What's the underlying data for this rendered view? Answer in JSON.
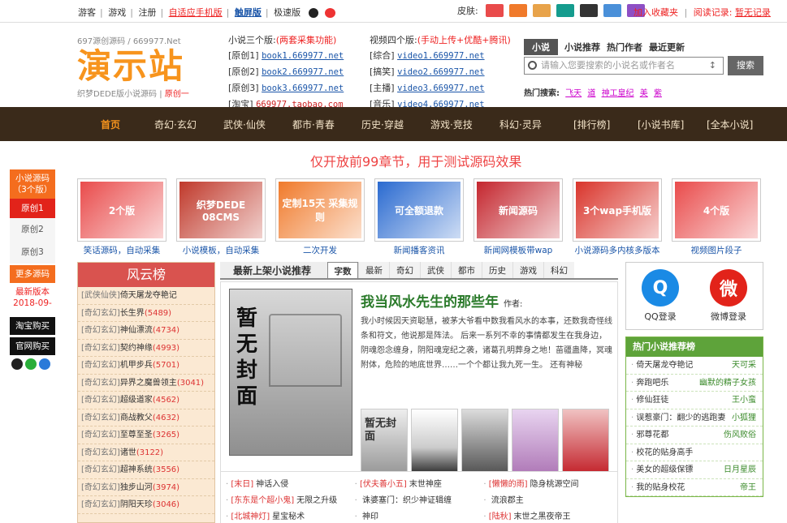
{
  "topbar": {
    "links": [
      "游客",
      "游戏",
      "注册",
      "自适应手机版",
      "触屏版",
      "极速版"
    ],
    "skin_label": "皮肤:",
    "skins": [
      "#e94b4b",
      "#f07a2b",
      "#e8a34a",
      "#159c8e",
      "#333333",
      "#4a90d9",
      "#8e4fc4"
    ],
    "bookmark": "加入收藏夹",
    "history": "阅读记录:",
    "history_link": "暂无记录"
  },
  "logo": {
    "sub1": "697源创源码 / 669977.Net",
    "big": "演示站",
    "sub2": "织梦DEDE版小说源码",
    "sub2_link": "原创一"
  },
  "novel_versions": {
    "title": "小说三个版:",
    "title_note": "(两套采集功能)",
    "rows": [
      {
        "label": "[原创1]",
        "link": "book1.669977.net"
      },
      {
        "label": "[原创2]",
        "link": "book2.669977.net"
      },
      {
        "label": "[原创3]",
        "link": "book3.669977.net"
      },
      {
        "label": "[淘宝]",
        "link": "669977.taobao.com"
      }
    ]
  },
  "video_versions": {
    "title": "视频四个版:",
    "title_note": "(手动上传+优酷+腾讯)",
    "rows": [
      {
        "label": "[综合]",
        "link": "video1.669977.net"
      },
      {
        "label": "[搞笑]",
        "link": "video2.669977.net"
      },
      {
        "label": "[主播]",
        "link": "video3.669977.net"
      },
      {
        "label": "[音乐]",
        "link": "video4.669977.net"
      }
    ]
  },
  "search": {
    "tabs": [
      "小说",
      "小说推荐",
      "热门作者",
      "最近更新"
    ],
    "placeholder": "请输入您要搜索的小说名或作者名",
    "button": "搜索",
    "hot_label": "热门搜索:",
    "hot": [
      "飞天",
      "道",
      "神工皇纪",
      "美",
      "紫"
    ]
  },
  "nav": [
    "首页",
    "奇幻·玄幻",
    "武侠·仙侠",
    "都市·青春",
    "历史·穿越",
    "游戏·竞技",
    "科幻·灵异",
    "[排行榜]",
    "[小说书库]",
    "[全本小说]"
  ],
  "notice": "仅开放前99章节，用于测试源码效果",
  "left_sidebar": {
    "title": "小说源码",
    "title_note": "（3个版）",
    "items": [
      "原创1",
      "原创2",
      "原创3"
    ],
    "more": "更多源码",
    "update": "最新版本2018-09-",
    "taobao": "淘宝购买",
    "official": "官网购买"
  },
  "banners": [
    {
      "caption": "笑话源码，自动采集",
      "text": "2个版",
      "color": "#e94b4b"
    },
    {
      "caption": "小说模板，自动采集",
      "text": "织梦DEDE 08CMS",
      "color": "#c0392b"
    },
    {
      "caption": "二次开发",
      "text": "定制15天 采集规则",
      "color": "#f07a2b"
    },
    {
      "caption": "新闻播客资讯",
      "text": "可全额退款",
      "color": "#2a6ad0"
    },
    {
      "caption": "新闻网模板带wap",
      "text": "新闻源码",
      "color": "#c4262e"
    },
    {
      "caption": "小说源码多内核多版本",
      "text": "3个wap手机版",
      "color": "#d9342b"
    },
    {
      "caption": "视频图片段子",
      "text": "4个版",
      "color": "#e94b4b"
    }
  ],
  "rank": {
    "title": "风云榜",
    "rows": [
      {
        "cat": "[武侠仙侠]",
        "name": "倚天屠龙夺艳记",
        "count": ""
      },
      {
        "cat": "[奇幻玄幻]",
        "name": "长生界",
        "count": "(5489)"
      },
      {
        "cat": "[奇幻玄幻]",
        "name": "神仙漂流",
        "count": "(4734)"
      },
      {
        "cat": "[奇幻玄幻]",
        "name": "契约神缘",
        "count": "(4993)"
      },
      {
        "cat": "[奇幻玄幻]",
        "name": "机甲步兵",
        "count": "(5701)"
      },
      {
        "cat": "[奇幻玄幻]",
        "name": "异界之魔兽领主",
        "count": "(3041)"
      },
      {
        "cat": "[奇幻玄幻]",
        "name": "超级道家",
        "count": "(4562)"
      },
      {
        "cat": "[奇幻玄幻]",
        "name": "商战教父",
        "count": "(4632)"
      },
      {
        "cat": "[奇幻玄幻]",
        "name": "至尊至圣",
        "count": "(3265)"
      },
      {
        "cat": "[奇幻玄幻]",
        "name": "诸世",
        "count": "(3122)"
      },
      {
        "cat": "[奇幻玄幻]",
        "name": "超神系统",
        "count": "(3556)"
      },
      {
        "cat": "[奇幻玄幻]",
        "name": "独步山河",
        "count": "(3974)"
      },
      {
        "cat": "[奇幻玄幻]",
        "name": "阴阳天珍",
        "count": "(3046)"
      }
    ]
  },
  "center": {
    "title": "最新上架小说推荐",
    "tabs": [
      "字数",
      "最新",
      "奇幻",
      "武侠",
      "都市",
      "历史",
      "游戏",
      "科幻"
    ],
    "cover_text": "暂无封面",
    "feature_title": "我当风水先生的那些年",
    "feature_author": "作者:",
    "feature_desc": "我小时候因天资聪慧，被茅大爷看中数我看风水的本事，还数我奇怪线条和符文，他说那是阵法。 后来一系列不幸的事情都发生在我身边，阴魂怨念缠身，阴阳魂宠纪之袭，诸葛孔明葬身之地！苗疆蛊降，冥魂附体，危险的地底世界……一个个都让我九死一生。 还有神秘",
    "thumbs": [
      "暂无封面",
      "人物",
      "女主",
      "魅力帝王",
      "红色"
    ],
    "list": [
      [
        {
          "c": "[末日]",
          "n": "神话入侵"
        },
        {
          "c": "[伏夫善小五]",
          "n": "末世神座"
        },
        {
          "c": "[懒懒的雨]",
          "n": "隐身桃源空间"
        }
      ],
      [
        {
          "c": "[东东是个超小鬼]",
          "n": "无限之升级"
        },
        {
          "c": "",
          "n": "诛婆塞门：织少神证辑缠"
        },
        {
          "c": "",
          "n": "流浪郡主"
        }
      ],
      [
        {
          "c": "[北城神灯]",
          "n": "星宝秘术"
        },
        {
          "c": "",
          "n": "神印"
        },
        {
          "c": "[陆秋]",
          "n": "末世之黑夜帝王"
        }
      ]
    ]
  },
  "social": {
    "qq": "QQ登录",
    "weibo": "微博登录"
  },
  "hot_novels": {
    "title": "热门小说推荐榜",
    "rows": [
      {
        "name": "倚天屠龙夺艳记",
        "author": "天可采"
      },
      {
        "name": "奔跑吧乐",
        "author": "幽默的精子女孩"
      },
      {
        "name": "修仙狂徒",
        "author": "王小蛮"
      },
      {
        "name": "误惹豪门：翻少的逃跑妻",
        "author": "小狐狸"
      },
      {
        "name": "邪尊花都",
        "author": "伤风败俗"
      },
      {
        "name": "校花的贴身高手",
        "author": ""
      },
      {
        "name": "美女的超级保镖",
        "author": "日月星辰"
      },
      {
        "name": "我的贴身校花",
        "author": "帝王"
      }
    ]
  }
}
